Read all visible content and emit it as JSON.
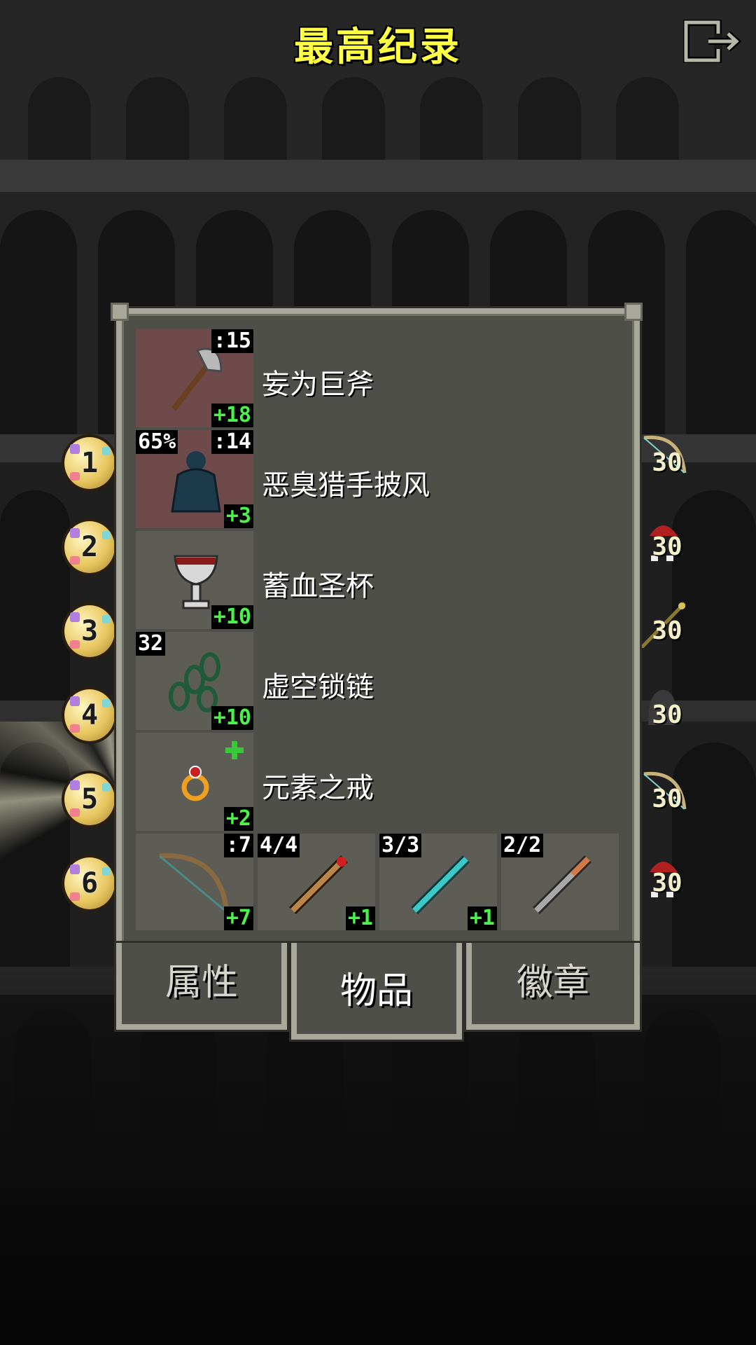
{
  "header": {
    "title": "最高纪录",
    "exit_icon": "exit-door-icon"
  },
  "ranks": [
    {
      "rank": "1",
      "level": "30",
      "class_icon": "huntress-bow-icon"
    },
    {
      "rank": "2",
      "level": "30",
      "class_icon": "warrior-helmet-icon"
    },
    {
      "rank": "3",
      "level": "30",
      "class_icon": "mage-staff-icon"
    },
    {
      "rank": "4",
      "level": "30",
      "class_icon": "rogue-hood-icon"
    },
    {
      "rank": "5",
      "level": "30",
      "class_icon": "huntress-bow-icon"
    },
    {
      "rank": "6",
      "level": "30",
      "class_icon": "warrior-helmet-icon"
    }
  ],
  "items": [
    {
      "name": "妄为巨斧",
      "icon": "greataxe-icon",
      "top_right": ":15",
      "bottom_right": "+18",
      "cursed": true
    },
    {
      "name": "恶臭猎手披风",
      "icon": "cloak-armor-icon",
      "top_left": "65%",
      "top_right": ":14",
      "bottom_right": "+3",
      "cursed": true
    },
    {
      "name": "蓄血圣杯",
      "icon": "chalice-icon",
      "bottom_right": "+10",
      "cursed": false
    },
    {
      "name": "虚空锁链",
      "icon": "chains-icon",
      "top_left": "32",
      "bottom_right": "+10",
      "cursed": false
    },
    {
      "name": "元素之戒",
      "icon": "ring-icon",
      "bottom_right": "+2",
      "cursed": false,
      "top_marker": "green-plus-icon"
    }
  ],
  "quickslots": [
    {
      "icon": "bow-icon",
      "top_right": ":7",
      "bottom_right": "+7"
    },
    {
      "icon": "wand-icon",
      "top_left": "4/4",
      "bottom_right": "+1"
    },
    {
      "icon": "crystal-wand-icon",
      "top_left": "3/3",
      "bottom_right": "+1"
    },
    {
      "icon": "copper-wand-icon",
      "top_left": "2/2"
    }
  ],
  "tabs": [
    {
      "label": "属性",
      "active": false
    },
    {
      "label": "物品",
      "active": true
    },
    {
      "label": "徽章",
      "active": false
    }
  ],
  "colors": {
    "title": "#ffff44",
    "upgrade_green": "#4df04d",
    "cursed_slot": "#6e4a4a",
    "panel_bg": "#4f4f49",
    "panel_border": "#a7a89a"
  }
}
